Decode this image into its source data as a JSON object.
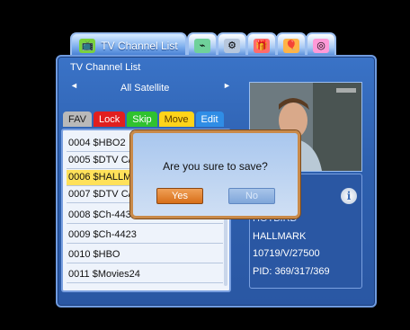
{
  "tabs": [
    {
      "label": "TV Channel List",
      "icon": "tv-icon",
      "color": "#7ad23b"
    },
    {
      "label": "",
      "icon": "satellite-dish-icon",
      "color": "#6fd19a"
    },
    {
      "label": "",
      "icon": "tools-icon",
      "color": "#b7c7dd"
    },
    {
      "label": "",
      "icon": "gift-icon",
      "color": "#ff6b6b"
    },
    {
      "label": "",
      "icon": "balloon-icon",
      "color": "#ffb347"
    },
    {
      "label": "",
      "icon": "disc-icon",
      "color": "#ff9ad8"
    }
  ],
  "panel": {
    "title": "TV Channel List",
    "satellite": "All Satellite",
    "left_arrow": "◄",
    "right_arrow": "►"
  },
  "function_buttons": [
    {
      "label": "FAV",
      "bg": "#b9b9b9",
      "fg": "#1c1c1c"
    },
    {
      "label": "Lock",
      "bg": "#e11f1f",
      "fg": "#ffffff"
    },
    {
      "label": "Skip",
      "bg": "#2fc22f",
      "fg": "#ffffff"
    },
    {
      "label": "Move",
      "bg": "#ffd41a",
      "fg": "#5a3a00"
    },
    {
      "label": "Edit",
      "bg": "#2f8de6",
      "fg": "#ffffff"
    }
  ],
  "channels": [
    {
      "label": "0004 $HBO2"
    },
    {
      "label": "0005 $DTV C/"
    },
    {
      "label": "0006 $HALLM",
      "selected": true
    },
    {
      "label": "0007 $DTV C/"
    },
    {
      "label": "0008 $Ch-4433"
    },
    {
      "label": "0009 $Ch-4423"
    },
    {
      "label": "0010 $HBO"
    },
    {
      "label": "0011 $Movies24"
    }
  ],
  "info": {
    "line1": "HOTBIRD",
    "line2": "HALLMARK",
    "line3": "10719/V/27500",
    "line4": "PID: 369/317/369",
    "info_glyph": "i"
  },
  "dialog": {
    "message": "Are you sure to save?",
    "yes": "Yes",
    "no": "No"
  }
}
